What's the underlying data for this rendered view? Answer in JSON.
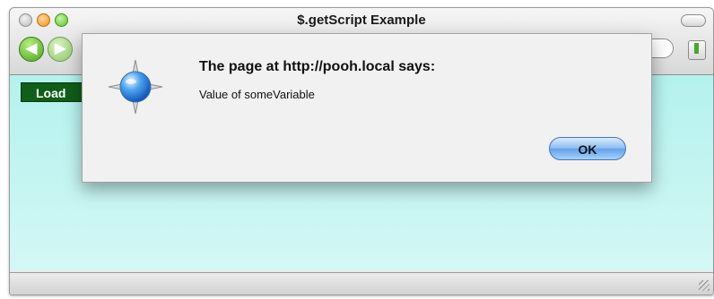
{
  "window": {
    "title": "$.getScript Example"
  },
  "toolbar": {
    "back_icon": "back-arrow-icon",
    "forward_icon": "forward-arrow-icon",
    "bookmark_icon": "bookmark-icon"
  },
  "page": {
    "button_label": "Load"
  },
  "dialog": {
    "title": "The page at http://pooh.local says:",
    "message": "Value of someVariable",
    "ok_label": "OK",
    "icon": "safari-compass-icon"
  },
  "colors": {
    "content_background": "#c4f5f2",
    "load_button": "#0f5e19",
    "ok_button": "#62a1ea"
  }
}
